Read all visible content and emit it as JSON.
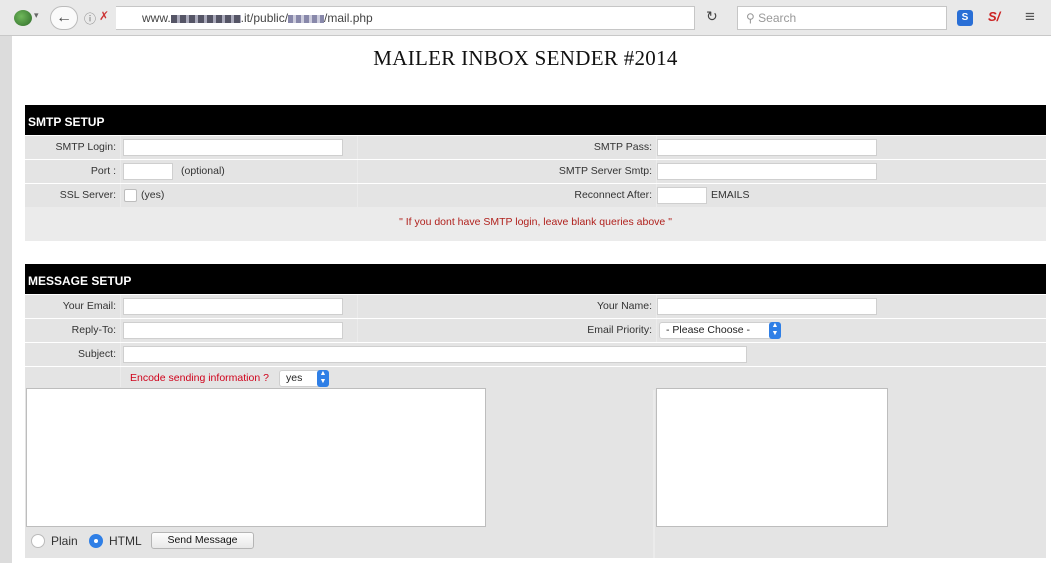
{
  "browser": {
    "url_prefix": "www.",
    "url_middle": ".it/public/",
    "url_suffix": "/mail.php",
    "search_placeholder": "Search"
  },
  "page": {
    "title": "MAILER INBOX SENDER #2014"
  },
  "smtp": {
    "heading": "SMTP SETUP",
    "login_label": "SMTP Login:",
    "pass_label": "SMTP Pass:",
    "port_label": "Port :",
    "port_hint": "(optional)",
    "server_label": "SMTP Server Smtp:",
    "ssl_label": "SSL Server:",
    "ssl_hint": "(yes)",
    "reconnect_label": "Reconnect After:",
    "reconnect_unit": "EMAILS",
    "note": "\" If you dont have SMTP login, leave blank queries above \""
  },
  "message": {
    "heading": "MESSAGE SETUP",
    "email_label": "Your Email:",
    "name_label": "Your Name:",
    "reply_label": "Reply-To:",
    "priority_label": "Email Priority:",
    "priority_value": "- Please Choose -",
    "subject_label": "Subject:",
    "encode_label": "Encode sending information ?",
    "encode_value": "yes",
    "plain_label": "Plain",
    "html_label": "HTML",
    "send_label": "Send Message"
  },
  "colors": {
    "header_bg": "#000000",
    "note": "#b0211d",
    "encode_label": "#d0021b",
    "accent": "#2f7fe6"
  }
}
